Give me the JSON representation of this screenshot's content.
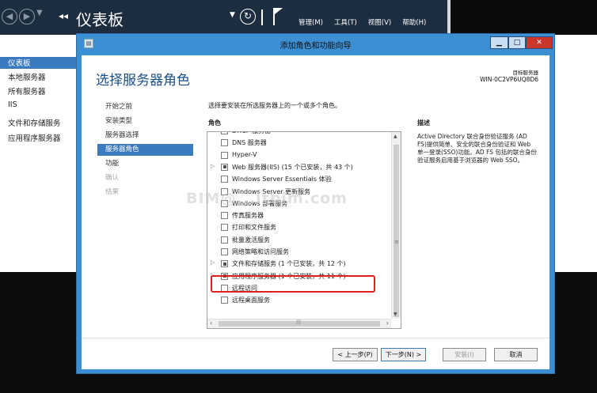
{
  "server_manager": {
    "title": "仪表板",
    "menus": [
      "管理(M)",
      "工具(T)",
      "视图(V)",
      "帮助(H)"
    ],
    "sidebar": [
      "仪表板",
      "本地服务器",
      "所有服务器",
      "IIS",
      "文件和存储服务",
      "应用程序服务器"
    ],
    "active_sidebar_index": 0
  },
  "wizard": {
    "window_title": "添加角色和功能向导",
    "page_title": "选择服务器角色",
    "target_label": "目标服务器",
    "target_server": "WIN-0C2VP6UQ8D6",
    "steps": [
      {
        "label": "开始之前",
        "state": "normal"
      },
      {
        "label": "安装类型",
        "state": "normal"
      },
      {
        "label": "服务器选择",
        "state": "normal"
      },
      {
        "label": "服务器角色",
        "state": "active"
      },
      {
        "label": "功能",
        "state": "normal"
      },
      {
        "label": "确认",
        "state": "disabled"
      },
      {
        "label": "结果",
        "state": "disabled"
      }
    ],
    "instruction": "选择要安装在所选服务器上的一个或多个角色。",
    "roles_header": "角色",
    "description_header": "描述",
    "description": "Active Directory 联合身份验证服务 (AD FS)提供简单、安全的联合身份验证和 Web 单一登录(SSO)功能。AD FS 包括的联合身份验证服务启用基于浏览器的 Web SSO。",
    "roles": [
      {
        "label": "DHCP 服务器",
        "expandable": false,
        "partial": false
      },
      {
        "label": "DNS 服务器",
        "expandable": false,
        "partial": false
      },
      {
        "label": "Hyper-V",
        "expandable": false,
        "partial": false
      },
      {
        "label": "Web 服务器(IIS) (15 个已安装，共 43 个)",
        "expandable": true,
        "partial": true
      },
      {
        "label": "Windows Server Essentials 体验",
        "expandable": false,
        "partial": false
      },
      {
        "label": "Windows Server 更新服务",
        "expandable": false,
        "partial": false
      },
      {
        "label": "Windows 部署服务",
        "expandable": false,
        "partial": false
      },
      {
        "label": "传真服务器",
        "expandable": false,
        "partial": false
      },
      {
        "label": "打印和文件服务",
        "expandable": false,
        "partial": false
      },
      {
        "label": "批量激活服务",
        "expandable": false,
        "partial": false
      },
      {
        "label": "网络策略和访问服务",
        "expandable": false,
        "partial": false
      },
      {
        "label": "文件和存储服务 (1 个已安装，共 12 个)",
        "expandable": true,
        "partial": true
      },
      {
        "label": "应用程序服务器 (1 个已安装，共 11 个)",
        "expandable": true,
        "partial": true
      },
      {
        "label": "远程访问",
        "expandable": false,
        "partial": false
      },
      {
        "label": "远程桌面服务",
        "expandable": false,
        "partial": false
      }
    ],
    "buttons": {
      "prev": "< 上一步(P)",
      "next": "下一步(N) >",
      "install": "安装(I)",
      "cancel": "取消"
    },
    "watermark": "BIM@...itbim.com"
  },
  "colors": {
    "header_bg": "#1c2d3f",
    "accent": "#3a7bbf",
    "title_blue": "#1b4f8a",
    "frame_blue": "#3d8fd4",
    "highlight_red": "#e02020"
  }
}
